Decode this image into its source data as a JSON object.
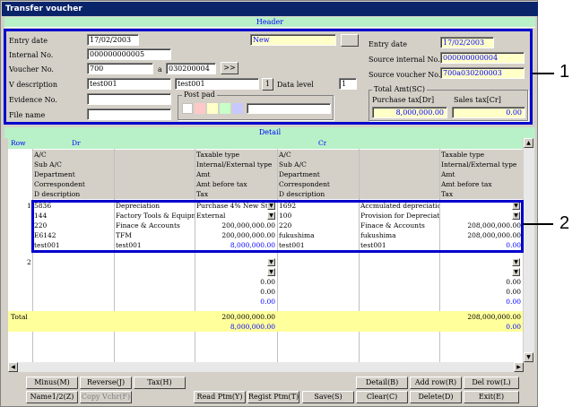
{
  "window": {
    "title": "Transfer voucher"
  },
  "header": {
    "bar_label": "Header",
    "entry_date_label": "Entry date",
    "entry_date": "17/02/2003",
    "status": "New",
    "internal_no_label": "Internal No.",
    "internal_no": "000000000005",
    "voucher_no_label": "Voucher No.",
    "voucher_no": "700",
    "voucher_a": "a",
    "voucher_no2": "030200004",
    "next_btn": ">>",
    "v_desc_label": "V description",
    "v_desc1": "test001",
    "v_desc2": "test001",
    "v_desc_btn": "1",
    "data_level_label": "Data level",
    "data_level": "1",
    "evidence_label": "Evidence No.",
    "filename_label": "File name",
    "post_pad_label": "Post pad",
    "r_entry_date_label": "Entry date",
    "r_entry_date": "17/02/2003",
    "source_internal_label": "Source internal No.",
    "source_internal": "000000000004",
    "source_voucher_label": "Source voucher No.",
    "source_voucher": "700a030200003",
    "total_amt_label": "Total Amt(SC)",
    "purchase_tax_label": "Purchase tax[Dr]",
    "sales_tax_label": "Sales tax[Cr]",
    "purchase_tax": "8,000,000.00",
    "sales_tax": "0.00",
    "swatch_colors": [
      "#ffffff",
      "#ffc8c8",
      "#ffffc8",
      "#c8ffc8",
      "#c8c8ff"
    ]
  },
  "detail": {
    "bar_label": "Detail",
    "col_row": "Row",
    "col_dr": "Dr",
    "col_cr": "Cr",
    "sub_left": [
      "A/C",
      "Sub A/C",
      "Department",
      "Correspondent",
      "D description"
    ],
    "sub_mid": [
      "Taxable type",
      "Internal/External type",
      "Amt",
      "Amt before tax",
      "Tax"
    ],
    "sub_right": [
      "A/C",
      "Sub A/C",
      "Department",
      "Correspondent",
      "D description"
    ],
    "sub_far": [
      "Taxable type",
      "Internal/External type",
      "Amt",
      "Amt before tax",
      "Tax"
    ],
    "row1": {
      "no": "1",
      "dr_code": [
        "5836",
        "144",
        "220",
        "E6142",
        "test001"
      ],
      "dr_name": [
        "Depreciation",
        "Factory Tools & Equipme",
        "Finace & Accounts",
        "TFM",
        "test001"
      ],
      "dr_type": [
        "Purchase 4% New Star",
        "External",
        "200,000,000.00",
        "200,000,000.00",
        "8,000,000.00"
      ],
      "cr_code": [
        "1692",
        "100",
        "220",
        "fukushima",
        "test001"
      ],
      "cr_name": [
        "Accmulated depreciation-F",
        "Provision for Depreciation",
        "Finace & Accounts",
        "fukushima",
        "test001"
      ],
      "cr_type": [
        "",
        "",
        "208,000,000.00",
        "208,000,000.00",
        "0.00"
      ]
    },
    "row2": {
      "no": "2",
      "dr_vals": [
        "0.00",
        "0.00",
        "0.00"
      ],
      "cr_vals": [
        "0.00",
        "0.00",
        "0.00"
      ]
    },
    "total_label": "Total",
    "total_dr1": "200,000,000.00",
    "total_dr2": "8,000,000.00",
    "total_cr1": "208,000,000.00",
    "total_cr2": "0.00"
  },
  "buttons": {
    "minus": "Minus(M)",
    "reverse": "Reverse(J)",
    "tax": "Tax(H)",
    "detail": "Detail(B)",
    "add_row": "Add row(R)",
    "del_row": "Del row(L)",
    "name12": "Name1/2(Z)",
    "copy_vchr": "Copy Vchr(F)",
    "read_ptm": "Read Ptm(Y)",
    "regist_ptm": "Regist Ptm(T)",
    "save": "Save(S)",
    "clear": "Clear(C)",
    "delete": "Delete(D)",
    "exit": "Exit(E)"
  },
  "callouts": [
    "1",
    "2"
  ]
}
